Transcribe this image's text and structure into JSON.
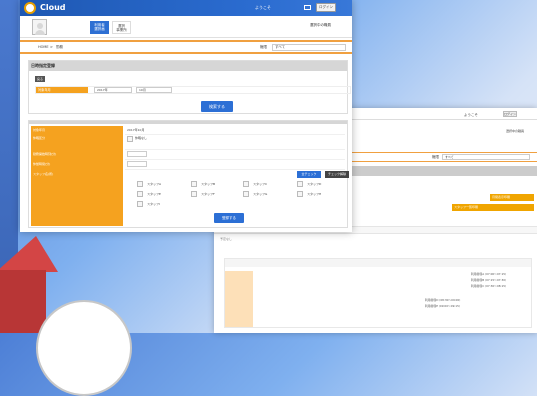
{
  "app": {
    "logo_text": "Cloud",
    "welcome": "ようこそ",
    "login_badge": "ログイン",
    "change_link": "選択中の職員",
    "nav": [
      {
        "label_line1": "利用者",
        "label_line2": "選択画"
      },
      {
        "label_line1": "選択",
        "label_line2": "事業所"
      }
    ]
  },
  "breadcrumb": {
    "home": "HOME",
    "sep": ">",
    "current": "勤務"
  },
  "permission": {
    "label": "権限",
    "value": "すべて"
  },
  "section1": {
    "title": "日時指定登録",
    "back_label": "戻る",
    "month_label": "対象年月",
    "year_value": "2017年",
    "month_value": "10月",
    "search_label": "検索する"
  },
  "section2": {
    "rows": [
      {
        "label": "対象年月",
        "value": "2017年10月"
      },
      {
        "label": "休暇区分",
        "value": "休暇なし"
      },
      {
        "label": "勤務開始時刻(分)",
        "value": ""
      },
      {
        "label": "休憩時間(分)",
        "value": ""
      },
      {
        "label": "スタッフ名(所)",
        "value": ""
      }
    ],
    "all_check_label": "全チェック",
    "release_label": "チェック解除",
    "staff": [
      "スタッフA",
      "スタッフB",
      "スタッフC",
      "スタッフD",
      "スタッフE",
      "スタッフF",
      "スタッフG",
      "スタッフH",
      "スタッフI"
    ],
    "register_label": "登録する"
  },
  "window2": {
    "welcome": "ようこそ",
    "login_badge": "ログイン",
    "change_link": "選択中の職員",
    "perm_label": "権限",
    "perm_value": "すべて",
    "btn_monthly": "月間表示印刷",
    "btn_staff": "スタッフ一覧印刷",
    "timeline": "7:00  8:00  9:00  10:00  11:00  12:00  13:00  14:00  15:00  16:00  17:00  18:00",
    "dot_label": "予定なし",
    "schedule_lines": [
      "利用者様A (07:00〜07:15)",
      "利用者様B (07:15〜07:30)",
      "利用者様C (07:30〜08:15)",
      "利用者様D (08:30〜09:00)",
      "利用者様E (09:00〜09:15)"
    ]
  },
  "colors": {
    "primary": "#2c6fd5",
    "accent": "#f5a21f"
  }
}
